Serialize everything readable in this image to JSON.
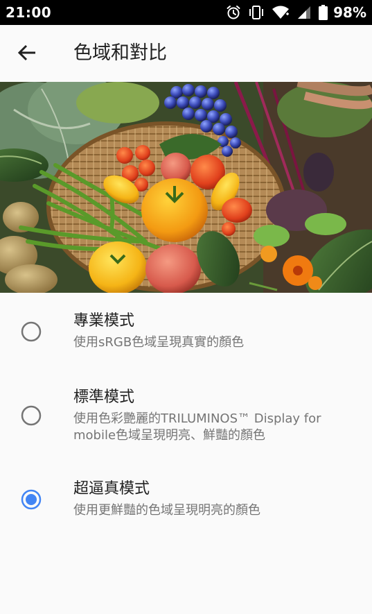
{
  "status_bar": {
    "time": "21:00",
    "battery": "98%",
    "icons": [
      "alarm-icon",
      "vibrate-icon",
      "wifi-icon",
      "cell-signal-icon",
      "battery-icon"
    ]
  },
  "app_bar": {
    "title": "色域和對比",
    "back_icon": "arrow-back-icon"
  },
  "options": [
    {
      "title": "專業模式",
      "description": "使用sRGB色域呈現真實的顏色",
      "selected": false
    },
    {
      "title": "標準模式",
      "description": "使用色彩艷麗的TRILUMINOS™ Display for mobile色域呈現明亮、鮮豔的顏色",
      "selected": false
    },
    {
      "title": "超逼真模式",
      "description": "使用更鮮豔的色域呈現明亮的顏色",
      "selected": true
    }
  ],
  "colors": {
    "accent": "#4285f4",
    "radio_off": "#757575",
    "text_primary": "#212121",
    "text_secondary": "#757575",
    "background": "#fafafa",
    "status_bar": "#000000"
  }
}
